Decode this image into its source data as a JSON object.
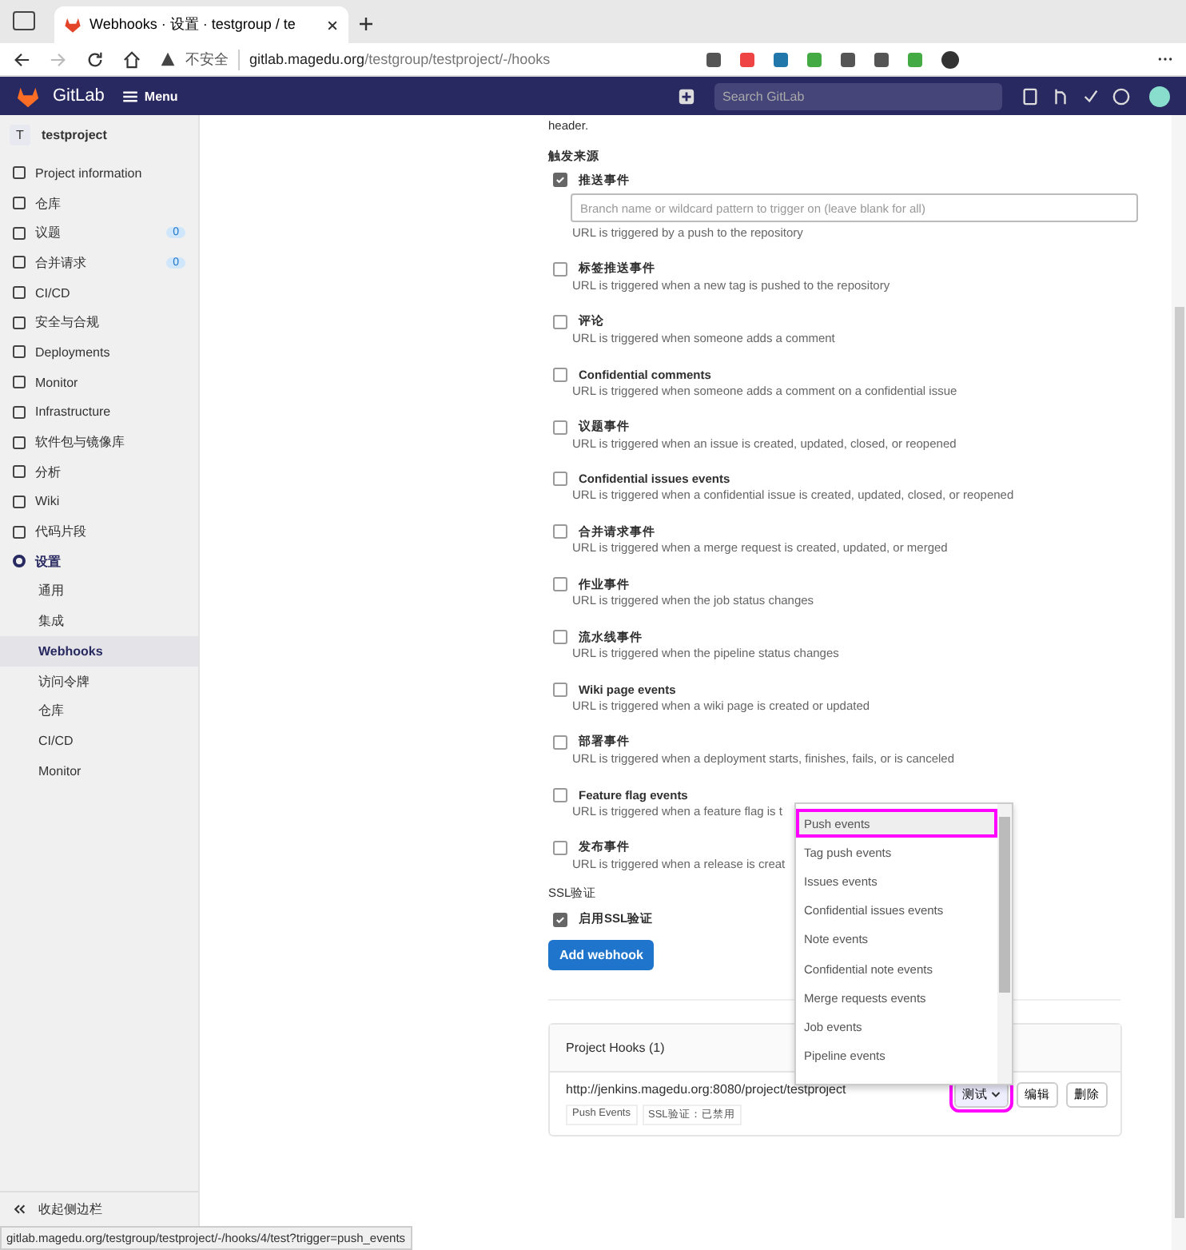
{
  "browser": {
    "tab_title": "Webhooks · 设置 · testgroup / te",
    "security": "不安全",
    "url_host": "gitlab.magedu.org",
    "url_path": "/testgroup/testproject/-/hooks"
  },
  "navbar": {
    "brand": "GitLab",
    "menu": "Menu",
    "search_placeholder": "Search GitLab"
  },
  "sidebar": {
    "project_initial": "T",
    "project": "testproject",
    "items": [
      {
        "label": "Project information",
        "selected": false
      },
      {
        "label": "仓库",
        "selected": false
      },
      {
        "label": "议题",
        "count": "0",
        "selected": false
      },
      {
        "label": "合并请求",
        "count": "0",
        "selected": false
      },
      {
        "label": "CI/CD",
        "selected": false
      },
      {
        "label": "安全与合规",
        "selected": false
      },
      {
        "label": "Deployments",
        "selected": false
      },
      {
        "label": "Monitor",
        "selected": false
      },
      {
        "label": "Infrastructure",
        "selected": false
      },
      {
        "label": "软件包与镜像库",
        "selected": false
      },
      {
        "label": "分析",
        "selected": false
      },
      {
        "label": "Wiki",
        "selected": false
      },
      {
        "label": "代码片段",
        "selected": false
      },
      {
        "label": "设置",
        "selected": true,
        "children": [
          {
            "label": "通用",
            "selected": false
          },
          {
            "label": "集成",
            "selected": false
          },
          {
            "label": "Webhooks",
            "selected": true
          },
          {
            "label": "访问令牌",
            "selected": false
          },
          {
            "label": "仓库",
            "selected": false
          },
          {
            "label": "CI/CD",
            "selected": false
          },
          {
            "label": "Monitor",
            "selected": false
          }
        ]
      }
    ],
    "collapse": "收起侧边栏"
  },
  "form": {
    "intro_tail": "header.",
    "trigger_heading": "触发来源",
    "branch_placeholder": "Branch name or wildcard pattern to trigger on (leave blank for all)",
    "events": [
      {
        "label": "推送事件",
        "checked": true,
        "description": "URL is triggered by a push to the repository"
      },
      {
        "label": "标签推送事件",
        "checked": false,
        "description": "URL is triggered when a new tag is pushed to the repository"
      },
      {
        "label": "评论",
        "checked": false,
        "description": "URL is triggered when someone adds a comment"
      },
      {
        "label": "Confidential comments",
        "checked": false,
        "description": "URL is triggered when someone adds a comment on a confidential issue"
      },
      {
        "label": "议题事件",
        "checked": false,
        "description": "URL is triggered when an issue is created, updated, closed, or reopened"
      },
      {
        "label": "Confidential issues events",
        "checked": false,
        "description": "URL is triggered when a confidential issue is created, updated, closed, or reopened"
      },
      {
        "label": "合并请求事件",
        "checked": false,
        "description": "URL is triggered when a merge request is created, updated, or merged"
      },
      {
        "label": "作业事件",
        "checked": false,
        "description": "URL is triggered when the job status changes"
      },
      {
        "label": "流水线事件",
        "checked": false,
        "description": "URL is triggered when the pipeline status changes"
      },
      {
        "label": "Wiki page events",
        "checked": false,
        "description": "URL is triggered when a wiki page is created or updated"
      },
      {
        "label": "部署事件",
        "checked": false,
        "description": "URL is triggered when a deployment starts, finishes, fails, or is canceled"
      },
      {
        "label": "Feature flag events",
        "checked": false,
        "description": "URL is triggered when a feature flag is t"
      },
      {
        "label": "发布事件",
        "checked": false,
        "description": "URL is triggered when a release is creat"
      }
    ],
    "ssl_heading": "SSL验证",
    "ssl_label": "启用SSL验证",
    "ssl_checked": true,
    "submit": "Add webhook"
  },
  "hooks": {
    "title": "Project Hooks (1)",
    "url": "http://jenkins.magedu.org:8080/project/testproject",
    "tags": [
      "Push Events",
      "SSL验证：已禁用"
    ],
    "test": "测试",
    "edit": "编辑",
    "delete": "删除"
  },
  "dropdown": [
    {
      "label": "Push events",
      "selected": true
    },
    {
      "label": "Tag push events",
      "selected": false
    },
    {
      "label": "Issues events",
      "selected": false
    },
    {
      "label": "Confidential issues events",
      "selected": false
    },
    {
      "label": "Note events",
      "selected": false
    },
    {
      "label": "Confidential note events",
      "selected": false
    },
    {
      "label": "Merge requests events",
      "selected": false
    },
    {
      "label": "Job events",
      "selected": false
    },
    {
      "label": "Pipeline events",
      "selected": false
    }
  ],
  "status_bar": "gitlab.magedu.org/testgroup/testproject/-/hooks/4/test?trigger=push_events"
}
